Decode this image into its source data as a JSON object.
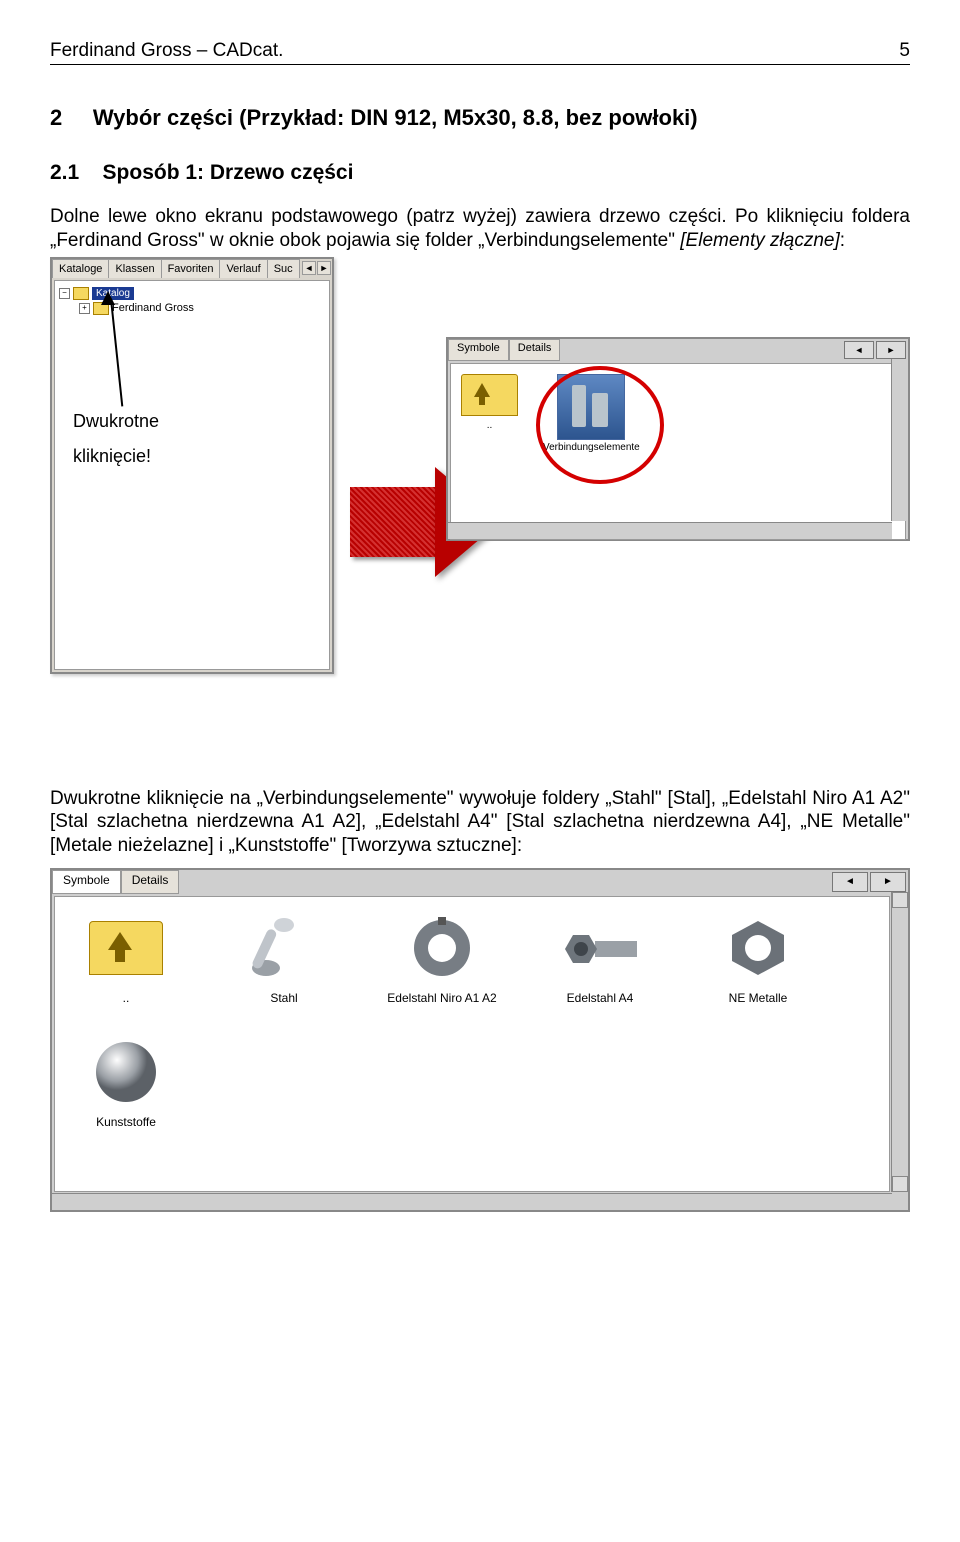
{
  "header": {
    "title": "Ferdinand Gross – CADcat.",
    "page": "5"
  },
  "section": {
    "num": "2",
    "title": "Wybór części (Przykład: DIN 912, M5x30, 8.8, bez powłoki)"
  },
  "subsection": {
    "num": "2.1",
    "title": "Sposób 1: Drzewo części"
  },
  "para_before": "Dolne lewe okno ekranu podstawowego (patrz wyżej) zawiera drzewo części. Po kliknięciu foldera „Ferdinand Gross\" w oknie obok pojawia się folder „Verbindungselemente\" ",
  "para_before_italic": "[Elementy złączne]",
  "para_before_tail": ":",
  "tree": {
    "tabs": [
      "Kataloge",
      "Klassen",
      "Favoriten",
      "Verlauf",
      "Suc"
    ],
    "root": "Katalog",
    "child": "Ferdinand Gross"
  },
  "callout": {
    "line1": "Dwukrotne",
    "line2": "kliknięcie!"
  },
  "icon_pane": {
    "tabs": [
      "Symbole",
      "Details"
    ],
    "up_label": "..",
    "item_label": "Verbindungselemente"
  },
  "para_after": "Dwukrotne kliknięcie na „Verbindungselemente\" wywołuje foldery „Stahl\" [Stal], „Edelstahl Niro A1 A2\" [Stal szlachetna nierdzewna A1 A2], „Edelstahl A4\" [Stal szlachetna nierdzewna A4], „NE Metalle\" [Metale nieżelazne] i „Kunststoffe\" [Tworzywa sztuczne]:",
  "lower": {
    "tabs": [
      "Symbole",
      "Details"
    ],
    "items": [
      {
        "label": ".."
      },
      {
        "label": "Stahl"
      },
      {
        "label": "Edelstahl Niro A1 A2"
      },
      {
        "label": "Edelstahl A4"
      },
      {
        "label": "NE Metalle"
      },
      {
        "label": "Kunststoffe"
      }
    ]
  }
}
